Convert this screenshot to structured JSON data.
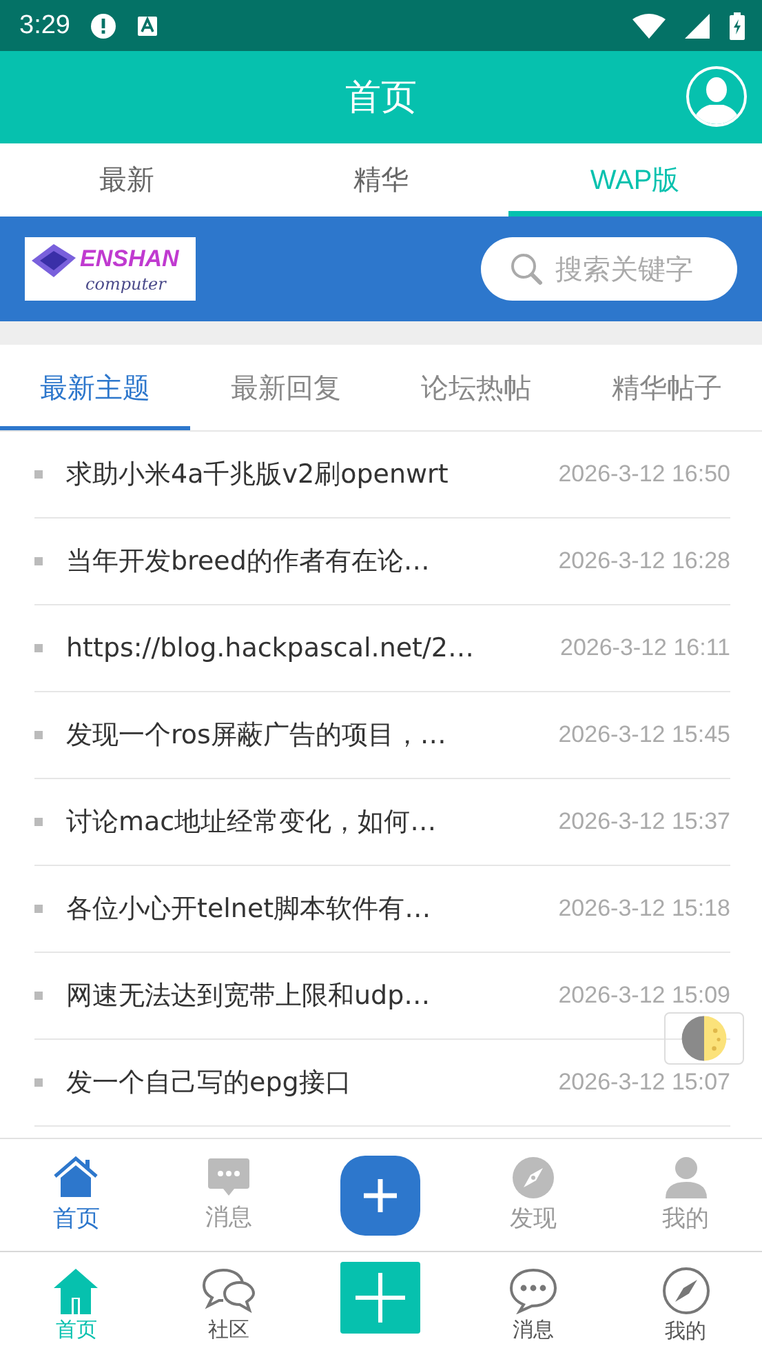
{
  "status_bar": {
    "time": "3:29"
  },
  "header": {
    "title": "首页"
  },
  "tabs": [
    {
      "label": "最新",
      "selected": false
    },
    {
      "label": "精华",
      "selected": false
    },
    {
      "label": "WAP版",
      "selected": true
    }
  ],
  "banner": {
    "logo_title": "ENSHAN",
    "logo_subtitle": "computer",
    "search": {
      "placeholder": "搜索关键字"
    }
  },
  "sub_tabs": [
    {
      "label": "最新主题",
      "selected": true
    },
    {
      "label": "最新回复",
      "selected": false
    },
    {
      "label": "论坛热帖",
      "selected": false
    },
    {
      "label": "精华帖子",
      "selected": false
    }
  ],
  "threads": [
    {
      "title": "求助小米4a千兆版v2刷openwrt",
      "time": "2026-3-12 16:50"
    },
    {
      "title": "当年开发breed的作者有在论…",
      "time": "2026-3-12 16:28"
    },
    {
      "title": "https://blog.hackpascal.net/2…",
      "time": "2026-3-12 16:11"
    },
    {
      "title": "发现一个ros屏蔽广告的项目，…",
      "time": "2026-3-12 15:45"
    },
    {
      "title": "讨论mac地址经常变化，如何…",
      "time": "2026-3-12 15:37"
    },
    {
      "title": "各位小心开telnet脚本软件有…",
      "time": "2026-3-12 15:18"
    },
    {
      "title": "网速无法达到宽带上限和udp…",
      "time": "2026-3-12 15:09"
    },
    {
      "title": "发一个自己写的epg接口",
      "time": "2026-3-12 15:07"
    }
  ],
  "site_nav": [
    {
      "kind": "home",
      "label": "首页",
      "selected": true
    },
    {
      "kind": "message",
      "label": "消息",
      "selected": false
    },
    {
      "kind": "plus"
    },
    {
      "kind": "discover",
      "label": "发现",
      "selected": false
    },
    {
      "kind": "me",
      "label": "我的",
      "selected": false
    }
  ],
  "app_nav": [
    {
      "kind": "home",
      "label": "首页",
      "selected": true
    },
    {
      "kind": "community",
      "label": "社区",
      "selected": false
    },
    {
      "kind": "plus"
    },
    {
      "kind": "message",
      "label": "消息",
      "selected": false
    },
    {
      "kind": "discover",
      "label": "我的",
      "selected": false
    }
  ]
}
